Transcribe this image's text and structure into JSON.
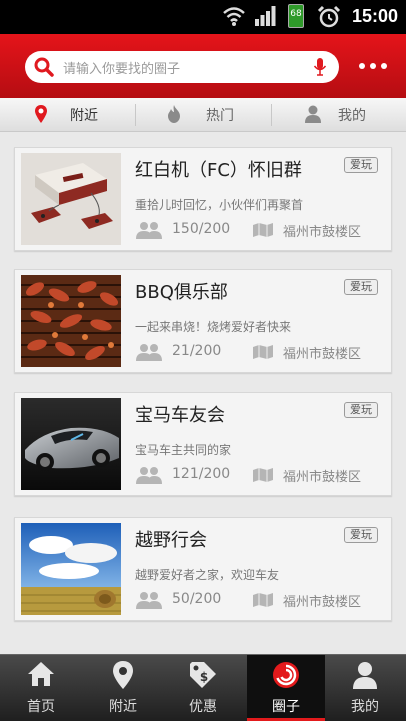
{
  "status_bar": {
    "time": "15:00",
    "battery": "68"
  },
  "header": {
    "search_placeholder": "请输入你要找的圈子",
    "accent_color": "#d81117"
  },
  "tabs": [
    {
      "label": "附近",
      "icon": "location-pin-icon",
      "active": true
    },
    {
      "label": "热门",
      "icon": "flame-icon",
      "active": false
    },
    {
      "label": "我的",
      "icon": "person-icon",
      "active": false
    }
  ],
  "groups": [
    {
      "title": "红白机（FC）怀旧群",
      "tag": "爱玩",
      "desc": "重拾儿时回忆，小伙伴们再聚首",
      "members": "150/200",
      "location": "福州市鼓楼区",
      "thumb": "famicom-console"
    },
    {
      "title": "BBQ俱乐部",
      "tag": "爱玩",
      "desc": "一起来串烧！烧烤爱好者快来",
      "members": "21/200",
      "location": "福州市鼓楼区",
      "thumb": "bbq-grill"
    },
    {
      "title": "宝马车友会",
      "tag": "爱玩",
      "desc": "宝马车主共同的家",
      "members": "121/200",
      "location": "福州市鼓楼区",
      "thumb": "sports-car"
    },
    {
      "title": "越野行会",
      "tag": "爱玩",
      "desc": "越野爱好者之家，欢迎车友",
      "members": "50/200",
      "location": "福州市鼓楼区",
      "thumb": "field-landscape"
    }
  ],
  "bottom_nav": [
    {
      "label": "首页",
      "icon": "home-icon",
      "active": false
    },
    {
      "label": "附近",
      "icon": "location-pin-icon",
      "active": false
    },
    {
      "label": "优惠",
      "icon": "coupon-tag-icon",
      "active": false
    },
    {
      "label": "圈子",
      "icon": "circle-swirl-icon",
      "active": true
    },
    {
      "label": "我的",
      "icon": "person-icon",
      "active": false
    }
  ]
}
